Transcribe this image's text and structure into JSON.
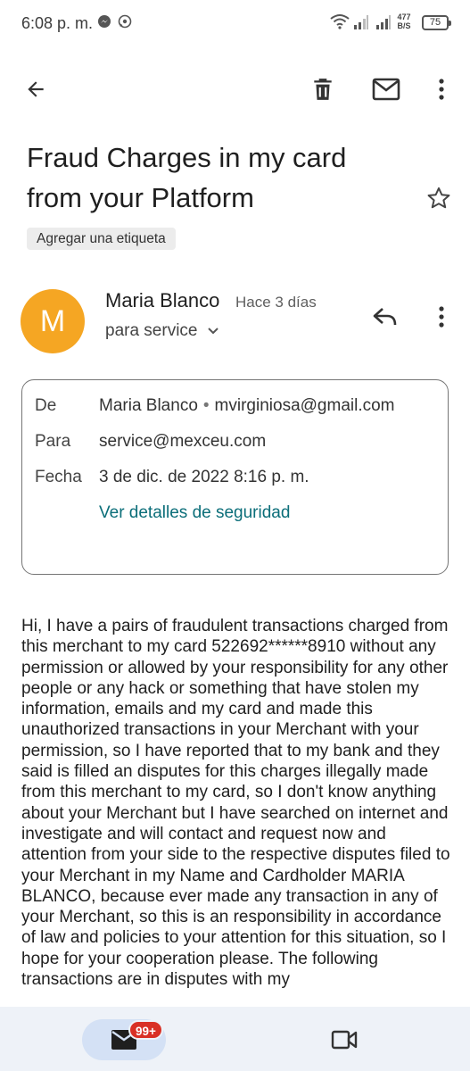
{
  "status_bar": {
    "time": "6:08 p. m.",
    "speed_value": "477",
    "speed_unit": "B/S",
    "battery": "75"
  },
  "email": {
    "subject": "Fraud Charges in my card from your Platform",
    "label_chip": "Agregar una etiqueta",
    "avatar_letter": "M",
    "sender_name": "Maria Blanco",
    "sent_ago": "Hace 3 días",
    "recipient_line": "para service",
    "details": {
      "from_label": "De",
      "from_name": "Maria Blanco",
      "from_email": "mvirginiosa@gmail.com",
      "to_label": "Para",
      "to_value": "service@mexceu.com",
      "date_label": "Fecha",
      "date_value": "3 de dic. de 2022 8:16 p. m.",
      "security_link": "Ver detalles de seguridad"
    },
    "body": "Hi, I have a pairs of fraudulent transactions charged from this merchant to my card 522692******8910 without any permission or allowed by your responsibility for any other people or any hack or something that have stolen my information, emails and my card and made this unauthorized transactions in your Merchant with your permission, so I have reported that to my bank and they said is filled an disputes for this charges illegally made from this merchant to my card, so I don't know anything about your Merchant but I have searched on internet and investigate and will contact and request now and attention from your side to the respective disputes filed to your Merchant in my Name and Cardholder MARIA BLANCO, because ever made any transaction in any of your Merchant, so this is an responsibility in accordance of law and policies to your attention for this situation, so I hope for your cooperation please. The following transactions are in disputes with my"
  },
  "bottom_nav": {
    "mail_badge": "99+"
  },
  "colors": {
    "avatar": "#f5a623",
    "link": "#0b6e79",
    "badge": "#d93025",
    "nav_bg": "#eef2f8",
    "active_tab": "#d4e1f5"
  }
}
